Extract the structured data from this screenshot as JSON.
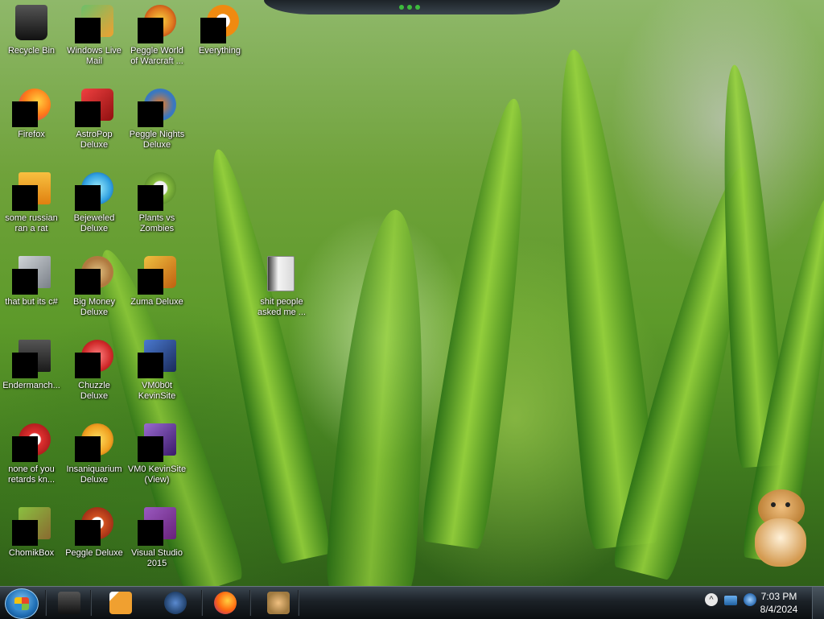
{
  "desktop": {
    "icons": [
      {
        "label": "Recycle Bin",
        "icon": "recycle-bin-icon",
        "color": "#1a1a1a"
      },
      {
        "label": "Windows Live\nMail",
        "icon": "mail-icon",
        "color": "#f0a030"
      },
      {
        "label": "Peggle World\nof Warcraft ...",
        "icon": "peggle-wow-icon",
        "color": "#e07a20"
      },
      {
        "label": "Everything",
        "icon": "everything-search-icon",
        "color": "#f08a10"
      },
      {
        "label": "Firefox",
        "icon": "firefox-icon",
        "color": "#ff7a18"
      },
      {
        "label": "AstroPop\nDeluxe",
        "icon": "astropop-icon",
        "color": "#c02020"
      },
      {
        "label": "Peggle Nights\nDeluxe",
        "icon": "peggle-nights-icon",
        "color": "#3a78c0"
      },
      {
        "label": "some russian\nran a rat",
        "icon": "java-archive-icon",
        "color": "#f0a020"
      },
      {
        "label": "Bejeweled\nDeluxe",
        "icon": "bejeweled-icon",
        "color": "#30a0e0"
      },
      {
        "label": "Plants vs\nZombies",
        "icon": "pvz-icon",
        "color": "#8ac040"
      },
      {
        "label": "that but its c#",
        "icon": "stacked-files-icon",
        "color": "#9aa0a6"
      },
      {
        "label": "Big Money\nDeluxe",
        "icon": "big-money-icon",
        "color": "#b07a40"
      },
      {
        "label": "Zuma Deluxe",
        "icon": "zuma-icon",
        "color": "#d09020"
      },
      {
        "label": "Endermanch...",
        "icon": "terminal-icon",
        "color": "#2b2b2b"
      },
      {
        "label": "Chuzzle\nDeluxe",
        "icon": "chuzzle-icon",
        "color": "#d02a2a"
      },
      {
        "label": "VM0b0t\nKevinSite",
        "icon": "vm-site-icon",
        "color": "#2a4a9a"
      },
      {
        "label": "none of you\nretards kn...",
        "icon": "red-app-icon",
        "color": "#e03030"
      },
      {
        "label": "Insaniquarium\nDeluxe",
        "icon": "insaniquarium-icon",
        "color": "#f0a020"
      },
      {
        "label": "VM0 KevinSite\n(View)",
        "icon": "vs-view-icon",
        "color": "#6a3aa0"
      },
      {
        "label": "ChomikBox",
        "icon": "chomikbox-icon",
        "color": "#8a6a30"
      },
      {
        "label": "Peggle Deluxe",
        "icon": "peggle-deluxe-icon",
        "color": "#d05020"
      },
      {
        "label": "Visual Studio\n2015",
        "icon": "visual-studio-icon",
        "color": "#68217a"
      },
      {
        "label": "shit people\nasked me ...",
        "icon": "folder-icon",
        "color": "#e8e8e8"
      }
    ]
  },
  "taskbar": {
    "start_icon": "windows-start-orb-icon",
    "pinned": [
      {
        "name": "file-explorer",
        "icon": "explorer-icon",
        "color": "#2a2a2a"
      },
      {
        "name": "media-player",
        "icon": "media-player-icon",
        "color": "#f0a030"
      },
      {
        "name": "globe-app",
        "icon": "globe-icon",
        "color": "#20406a"
      },
      {
        "name": "firefox",
        "icon": "firefox-icon",
        "color": "#ff6a10"
      },
      {
        "name": "chomikbox",
        "icon": "hamster-icon",
        "color": "#a07a40"
      }
    ],
    "tray": {
      "icons": [
        "show-hidden-icons-chevron-icon",
        "network-icon",
        "bluetooth-icon"
      ],
      "time": "7:03 PM",
      "date": "8/4/2024"
    }
  }
}
